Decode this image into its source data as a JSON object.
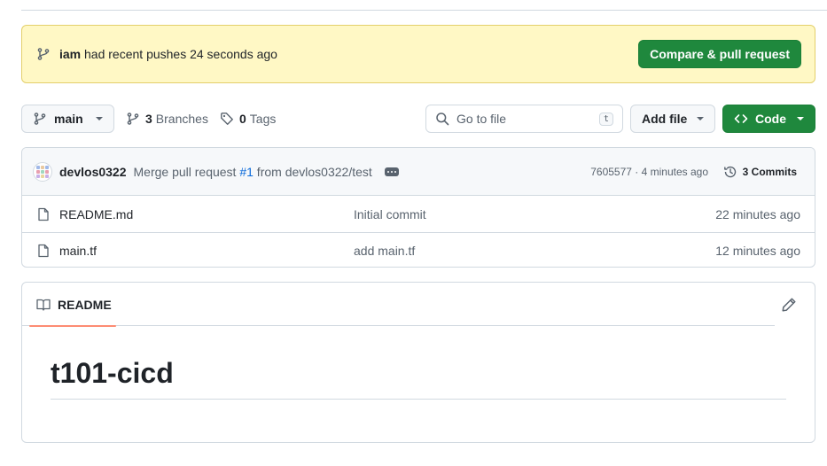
{
  "banner": {
    "user": "iam",
    "message": "had recent pushes 24 seconds ago",
    "compare_label": "Compare & pull request"
  },
  "toolbar": {
    "branch": "main",
    "branches_count": "3",
    "branches_label": "Branches",
    "tags_count": "0",
    "tags_label": "Tags",
    "search_placeholder": "Go to file",
    "search_shortcut": "t",
    "add_file_label": "Add file",
    "code_label": "Code"
  },
  "commit": {
    "author": "devlos0322",
    "message_prefix": "Merge pull request ",
    "pr_ref": "#1",
    "message_suffix": " from devlos0322/test",
    "hash_time": "7605577 · 4 minutes ago",
    "commits_label": "3 Commits"
  },
  "files": [
    {
      "name": "README.md",
      "commit": "Initial commit",
      "time": "22 minutes ago"
    },
    {
      "name": "main.tf",
      "commit": "add main.tf",
      "time": "12 minutes ago"
    }
  ],
  "readme": {
    "tab_label": "README",
    "title": "t101-cicd"
  },
  "colors": {
    "accent_green": "#1f883d",
    "banner_bg": "#fff8c5",
    "link_blue": "#0969da",
    "tab_underline": "#fd8c73"
  }
}
